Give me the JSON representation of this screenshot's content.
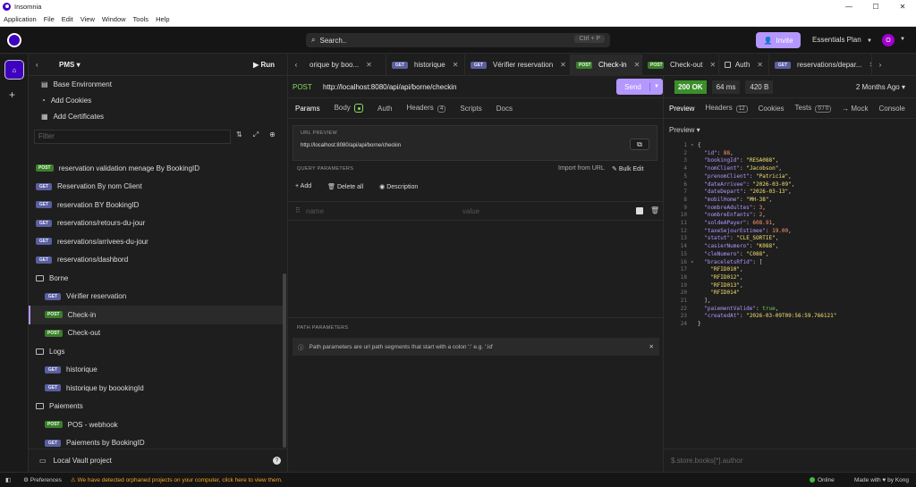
{
  "window": {
    "title": "Insomnia",
    "minimize": "—",
    "maximize": "☐",
    "close": "✕"
  },
  "menu": [
    "Application",
    "File",
    "Edit",
    "View",
    "Window",
    "Tools",
    "Help"
  ],
  "top": {
    "search_placeholder": "Search..",
    "search_shortcut": "Ctrl + P",
    "invite": "Invite",
    "plan": "Essentials Plan",
    "avatar": "O"
  },
  "sidebar": {
    "project": "PMS",
    "run": "Run",
    "env": [
      "Base Environment",
      "Add Cookies",
      "Add Certificates"
    ],
    "filter_placeholder": "Filter",
    "tree": [
      {
        "kind": "req",
        "method": "POST",
        "label": "reservation validation menage By BookingID",
        "indent": 1
      },
      {
        "kind": "req",
        "method": "GET",
        "label": "Reservation By nom Client",
        "indent": 1
      },
      {
        "kind": "req",
        "method": "GET",
        "label": "reservation BY BookingID",
        "indent": 1
      },
      {
        "kind": "req",
        "method": "GET",
        "label": "reservations/retours-du-jour",
        "indent": 1
      },
      {
        "kind": "req",
        "method": "GET",
        "label": "reservations/arrivees-du-jour",
        "indent": 1
      },
      {
        "kind": "req",
        "method": "GET",
        "label": "reservations/dashbord",
        "indent": 1
      },
      {
        "kind": "folder",
        "label": "Borne",
        "indent": 1
      },
      {
        "kind": "req",
        "method": "GET",
        "label": "Vérifier reservation",
        "indent": 2
      },
      {
        "kind": "req",
        "method": "POST",
        "label": "Check-in",
        "indent": 2,
        "active": true
      },
      {
        "kind": "req",
        "method": "POST",
        "label": "Check-out",
        "indent": 2
      },
      {
        "kind": "folder",
        "label": "Logs",
        "indent": 1
      },
      {
        "kind": "req",
        "method": "GET",
        "label": "historique",
        "indent": 2
      },
      {
        "kind": "req",
        "method": "GET",
        "label": "historique by boookingId",
        "indent": 2
      },
      {
        "kind": "folder",
        "label": "Paiements",
        "indent": 1
      },
      {
        "kind": "req",
        "method": "POST",
        "label": "POS - webhook",
        "indent": 2
      },
      {
        "kind": "req",
        "method": "GET",
        "label": "Paiements by BookingID",
        "indent": 2
      }
    ],
    "vault": "Local Vault project"
  },
  "tabs": [
    {
      "method": "",
      "label": "orique by boo...",
      "icon": ""
    },
    {
      "method": "GET",
      "label": "historique"
    },
    {
      "method": "GET",
      "label": "Vérifier reservation"
    },
    {
      "method": "POST",
      "label": "Check-in",
      "active": true
    },
    {
      "method": "POST",
      "label": "Check-out"
    },
    {
      "method": "",
      "label": "Auth",
      "icon": "folder"
    },
    {
      "method": "GET",
      "label": "reservations/depar..."
    }
  ],
  "request": {
    "method": "POST",
    "url": "http://localhost:8080/api/api/borne/checkin",
    "send": "Send",
    "tabs": {
      "params": "Params",
      "body": "Body",
      "auth": "Auth",
      "headers": "Headers",
      "headers_count": "4",
      "scripts": "Scripts",
      "docs": "Docs"
    },
    "preview_header": "URL PREVIEW",
    "preview_url": "http://localhost:8080/api/api/borne/checkin",
    "qp_header": "QUERY PARAMETERS",
    "import_url": "Import from URL",
    "bulk_edit": "Bulk Edit",
    "add": "Add",
    "delete_all": "Delete all",
    "description": "Description",
    "name_ph": "name",
    "value_ph": "value",
    "pp_header": "PATH PARAMETERS",
    "pp_info": "Path parameters are url path segments that start with a colon ':' e.g. ':id'"
  },
  "response": {
    "status": "200 OK",
    "time": "64 ms",
    "size": "420 B",
    "ago": "2 Months Ago",
    "tabs": {
      "preview": "Preview",
      "headers": "Headers",
      "headers_count": "12",
      "cookies": "Cookies",
      "tests": "Tests",
      "tests_count": "0 / 0",
      "mock": "→ Mock",
      "console": "Console"
    },
    "preview_mode": "Preview",
    "lines": [
      [
        {
          "t": "p",
          "v": "{"
        }
      ],
      [
        {
          "t": "k",
          "v": "  \"id\""
        },
        {
          "t": "p",
          "v": ": "
        },
        {
          "t": "nn",
          "v": "88"
        },
        {
          "t": "p",
          "v": ","
        }
      ],
      [
        {
          "t": "k",
          "v": "  \"bookingId\""
        },
        {
          "t": "p",
          "v": ": "
        },
        {
          "t": "s",
          "v": "\"RESA088\""
        },
        {
          "t": "p",
          "v": ","
        }
      ],
      [
        {
          "t": "k",
          "v": "  \"nomClient\""
        },
        {
          "t": "p",
          "v": ": "
        },
        {
          "t": "s",
          "v": "\"Jacobson\""
        },
        {
          "t": "p",
          "v": ","
        }
      ],
      [
        {
          "t": "k",
          "v": "  \"prenomClient\""
        },
        {
          "t": "p",
          "v": ": "
        },
        {
          "t": "s",
          "v": "\"Patricia\""
        },
        {
          "t": "p",
          "v": ","
        }
      ],
      [
        {
          "t": "k",
          "v": "  \"dateArrivee\""
        },
        {
          "t": "p",
          "v": ": "
        },
        {
          "t": "s",
          "v": "\"2026-03-09\""
        },
        {
          "t": "p",
          "v": ","
        }
      ],
      [
        {
          "t": "k",
          "v": "  \"dateDepart\""
        },
        {
          "t": "p",
          "v": ": "
        },
        {
          "t": "s",
          "v": "\"2026-03-13\""
        },
        {
          "t": "p",
          "v": ","
        }
      ],
      [
        {
          "t": "k",
          "v": "  \"mobilHome\""
        },
        {
          "t": "p",
          "v": ": "
        },
        {
          "t": "s",
          "v": "\"MH-38\""
        },
        {
          "t": "p",
          "v": ","
        }
      ],
      [
        {
          "t": "k",
          "v": "  \"nombreAdultes\""
        },
        {
          "t": "p",
          "v": ": "
        },
        {
          "t": "nn",
          "v": "3"
        },
        {
          "t": "p",
          "v": ","
        }
      ],
      [
        {
          "t": "k",
          "v": "  \"nombreEnfants\""
        },
        {
          "t": "p",
          "v": ": "
        },
        {
          "t": "nn",
          "v": "2"
        },
        {
          "t": "p",
          "v": ","
        }
      ],
      [
        {
          "t": "k",
          "v": "  \"soldeAPayer\""
        },
        {
          "t": "p",
          "v": ": "
        },
        {
          "t": "nn",
          "v": "608.91"
        },
        {
          "t": "p",
          "v": ","
        }
      ],
      [
        {
          "t": "k",
          "v": "  \"taxeSejourEstimee\""
        },
        {
          "t": "p",
          "v": ": "
        },
        {
          "t": "nn",
          "v": "19.00"
        },
        {
          "t": "p",
          "v": ","
        }
      ],
      [
        {
          "t": "k",
          "v": "  \"statut\""
        },
        {
          "t": "p",
          "v": ": "
        },
        {
          "t": "s",
          "v": "\"CLE_SORTIE\""
        },
        {
          "t": "p",
          "v": ","
        }
      ],
      [
        {
          "t": "k",
          "v": "  \"casierNumero\""
        },
        {
          "t": "p",
          "v": ": "
        },
        {
          "t": "s",
          "v": "\"K088\""
        },
        {
          "t": "p",
          "v": ","
        }
      ],
      [
        {
          "t": "k",
          "v": "  \"cleNumero\""
        },
        {
          "t": "p",
          "v": ": "
        },
        {
          "t": "s",
          "v": "\"C088\""
        },
        {
          "t": "p",
          "v": ","
        }
      ],
      [
        {
          "t": "k",
          "v": "  \"braceletsRfid\""
        },
        {
          "t": "p",
          "v": ": ["
        }
      ],
      [
        {
          "t": "s",
          "v": "    \"RFID010\""
        },
        {
          "t": "p",
          "v": ","
        }
      ],
      [
        {
          "t": "s",
          "v": "    \"RFID012\""
        },
        {
          "t": "p",
          "v": ","
        }
      ],
      [
        {
          "t": "s",
          "v": "    \"RFID013\""
        },
        {
          "t": "p",
          "v": ","
        }
      ],
      [
        {
          "t": "s",
          "v": "    \"RFID014\""
        }
      ],
      [
        {
          "t": "p",
          "v": "  ],"
        }
      ],
      [
        {
          "t": "k",
          "v": "  \"paiementValide\""
        },
        {
          "t": "p",
          "v": ": "
        },
        {
          "t": "b",
          "v": "true"
        },
        {
          "t": "p",
          "v": ","
        }
      ],
      [
        {
          "t": "k",
          "v": "  \"createdAt\""
        },
        {
          "t": "p",
          "v": ": "
        },
        {
          "t": "s",
          "v": "\"2026-03-09T09:56:59.766121\""
        }
      ],
      [
        {
          "t": "p",
          "v": "}"
        }
      ]
    ],
    "fold_lines": [
      1,
      16
    ],
    "jq_placeholder": "$.store.books[*].author"
  },
  "status": {
    "preferences": "Preferences",
    "warning": "We have detected orphaned projects on your computer, click here to view them.",
    "online": "Online",
    "made": "Made with ♥ by Kong"
  },
  "colors": {
    "accent": "#b497ff",
    "post": "#8bd95f",
    "get_badge": "#5a5f9e",
    "post_badge": "#3b7d2c",
    "ok": "#3b8f2a"
  }
}
